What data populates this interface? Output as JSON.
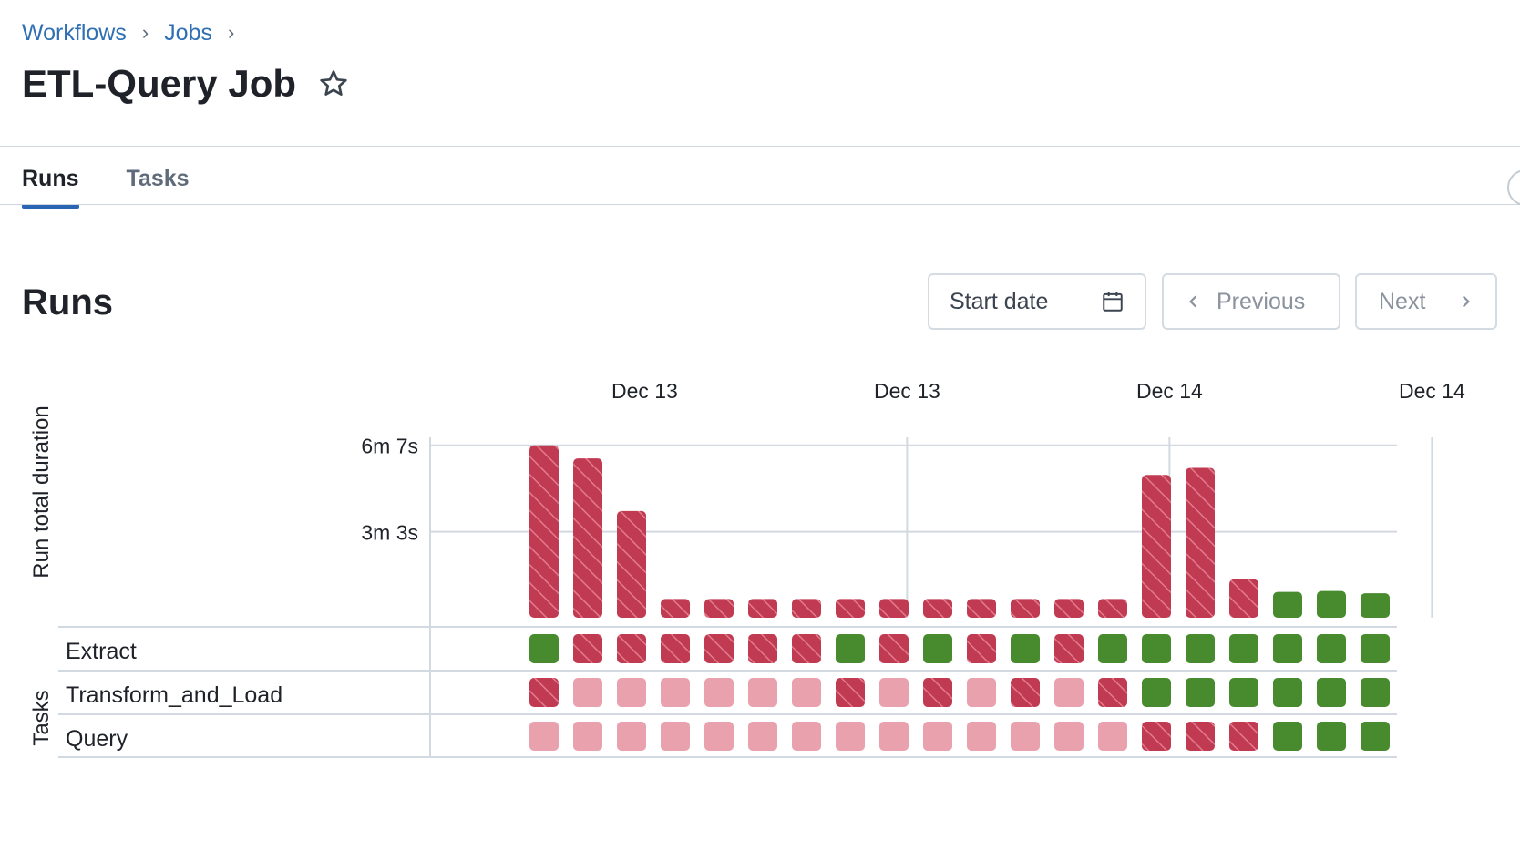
{
  "breadcrumb": {
    "items": [
      "Workflows",
      "Jobs"
    ],
    "separator": "›"
  },
  "page": {
    "title": "ETL-Query Job"
  },
  "tabs": [
    {
      "label": "Runs",
      "active": true
    },
    {
      "label": "Tasks",
      "active": false
    }
  ],
  "runs_section": {
    "title": "Runs",
    "start_date_label": "Start date",
    "previous_label": "Previous",
    "next_label": "Next"
  },
  "colors": {
    "link": "#2f6fb4",
    "tab_active_underline": "#2a64b4",
    "failed": "#c03a52",
    "failed_stripe": "#e37b8d",
    "skipped": "#e8a1ad",
    "succeeded": "#488a2e"
  },
  "chart_data": {
    "type": "bar",
    "ylabel": "Run total duration",
    "ytick_labels": [
      "6m 7s",
      "3m 3s"
    ],
    "ytick_values_s": [
      367,
      183
    ],
    "x_tick_labels": [
      "Dec 13",
      "Dec 13",
      "Dec 14",
      "Dec 14"
    ],
    "x_tick_run_index": [
      2.3,
      8.3,
      14.3,
      20.3
    ],
    "ylim_s": [
      0,
      380
    ],
    "grid": true,
    "runs": [
      {
        "duration_s": 367,
        "status": "failed"
      },
      {
        "duration_s": 339,
        "status": "failed"
      },
      {
        "duration_s": 227,
        "status": "failed"
      },
      {
        "duration_s": 40,
        "status": "failed"
      },
      {
        "duration_s": 40,
        "status": "failed"
      },
      {
        "duration_s": 40,
        "status": "failed"
      },
      {
        "duration_s": 40,
        "status": "failed"
      },
      {
        "duration_s": 40,
        "status": "failed"
      },
      {
        "duration_s": 40,
        "status": "failed"
      },
      {
        "duration_s": 40,
        "status": "failed"
      },
      {
        "duration_s": 40,
        "status": "failed"
      },
      {
        "duration_s": 40,
        "status": "failed"
      },
      {
        "duration_s": 40,
        "status": "failed"
      },
      {
        "duration_s": 40,
        "status": "failed"
      },
      {
        "duration_s": 304,
        "status": "failed"
      },
      {
        "duration_s": 319,
        "status": "failed"
      },
      {
        "duration_s": 82,
        "status": "failed"
      },
      {
        "duration_s": 55,
        "status": "succeeded"
      },
      {
        "duration_s": 57,
        "status": "succeeded"
      },
      {
        "duration_s": 52,
        "status": "succeeded"
      }
    ],
    "tasks_label": "Tasks",
    "tasks": [
      {
        "name": "Extract",
        "statuses": [
          "succeeded",
          "failed",
          "failed",
          "failed",
          "failed",
          "failed",
          "failed",
          "succeeded",
          "failed",
          "succeeded",
          "failed",
          "succeeded",
          "failed",
          "succeeded",
          "succeeded",
          "succeeded",
          "succeeded",
          "succeeded",
          "succeeded",
          "succeeded"
        ]
      },
      {
        "name": "Transform_and_Load",
        "statuses": [
          "failed",
          "skipped",
          "skipped",
          "skipped",
          "skipped",
          "skipped",
          "skipped",
          "failed",
          "skipped",
          "failed",
          "skipped",
          "failed",
          "skipped",
          "failed",
          "succeeded",
          "succeeded",
          "succeeded",
          "succeeded",
          "succeeded",
          "succeeded"
        ]
      },
      {
        "name": "Query",
        "statuses": [
          "skipped",
          "skipped",
          "skipped",
          "skipped",
          "skipped",
          "skipped",
          "skipped",
          "skipped",
          "skipped",
          "skipped",
          "skipped",
          "skipped",
          "skipped",
          "skipped",
          "failed",
          "failed",
          "failed",
          "succeeded",
          "succeeded",
          "succeeded"
        ]
      }
    ]
  }
}
